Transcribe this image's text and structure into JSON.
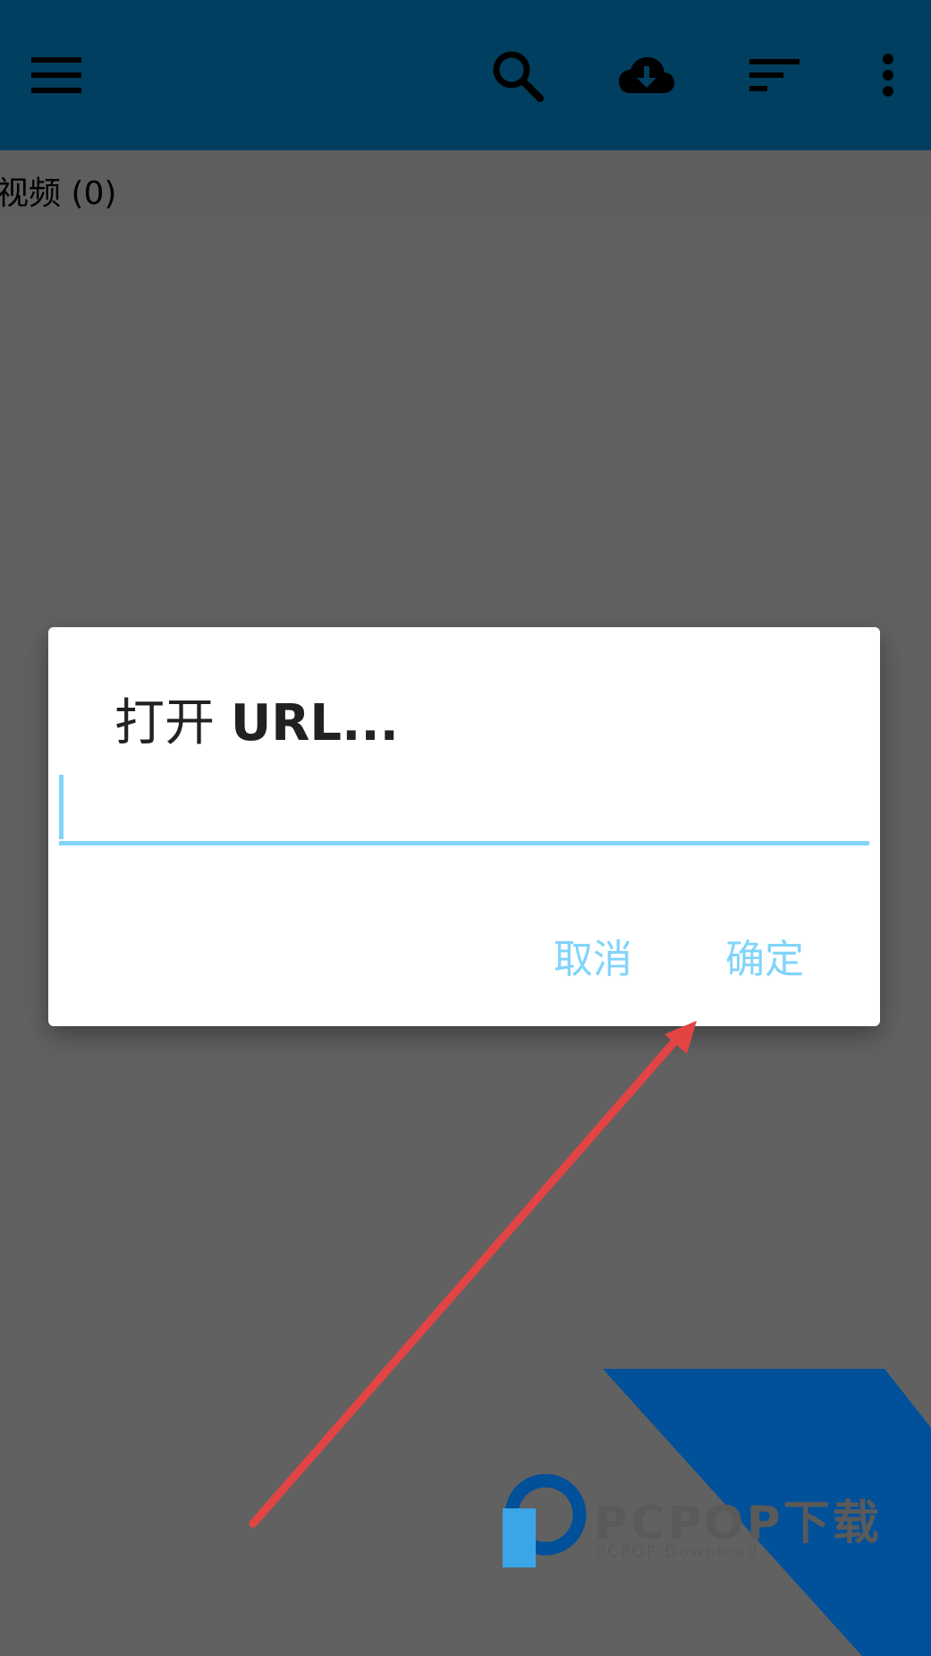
{
  "toolbar": {
    "background": "#003f5f",
    "icons": [
      "menu-icon",
      "search-icon",
      "cloud-download-icon",
      "sort-icon",
      "more-vert-icon"
    ]
  },
  "tabs": [
    {
      "label": "视频 (0)"
    }
  ],
  "dialog": {
    "title_prefix": "打开 ",
    "title_bold": "URL...",
    "input_value": "",
    "cancel_label": "取消",
    "ok_label": "确定",
    "accent_color": "#81d4fa"
  },
  "annotation": {
    "arrow_color": "#e24444"
  },
  "watermark": {
    "text": "PCPOP下载",
    "subtext": "PCPOP Download",
    "color": "#00509a"
  }
}
